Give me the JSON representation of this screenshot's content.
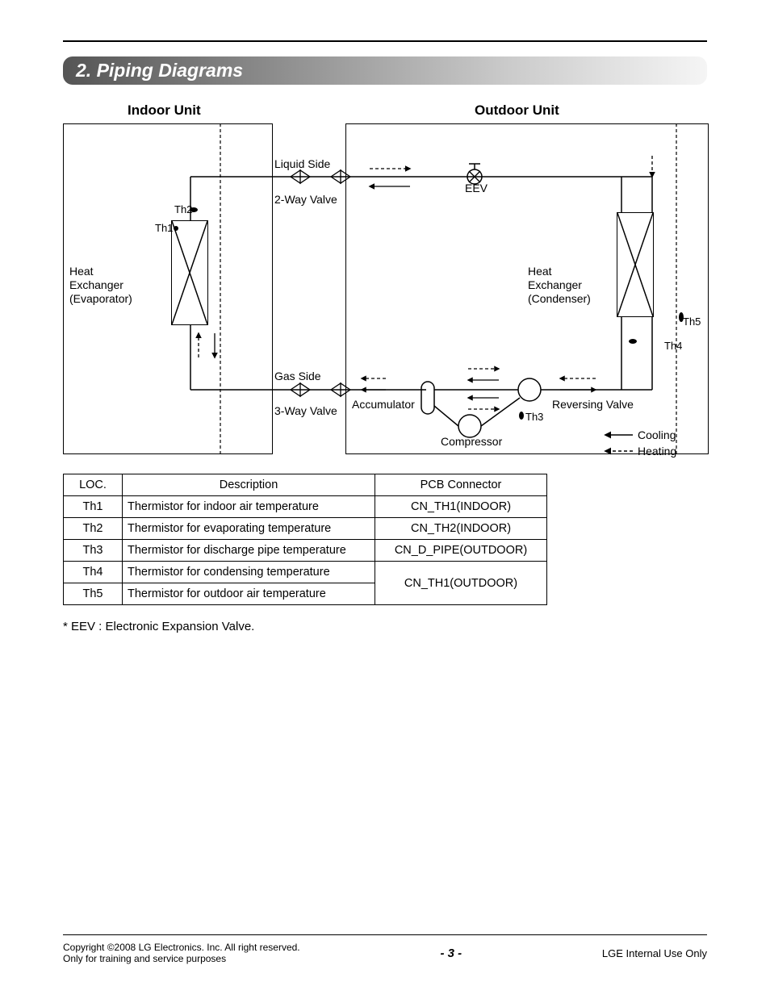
{
  "section_title": "2. Piping Diagrams",
  "diagram": {
    "indoor_unit": "Indoor Unit",
    "outdoor_unit": "Outdoor Unit",
    "liquid_side": "Liquid Side",
    "two_way_valve": "2-Way Valve",
    "gas_side": "Gas Side",
    "three_way_valve": "3-Way Valve",
    "heat_ex_evap_l1": "Heat",
    "heat_ex_evap_l2": "Exchanger",
    "heat_ex_evap_l3": "(Evaporator)",
    "heat_ex_cond_l1": "Heat",
    "heat_ex_cond_l2": "Exchanger",
    "heat_ex_cond_l3": "(Condenser)",
    "eev": "EEV",
    "accumulator": "Accumulator",
    "compressor": "Compressor",
    "reversing_valve": "Reversing Valve",
    "th1": "Th1",
    "th2": "Th2",
    "th3": "Th3",
    "th4": "Th4",
    "th5": "Th5",
    "cooling": "Cooling",
    "heating": "Heating"
  },
  "table": {
    "headers": {
      "loc": "LOC.",
      "desc": "Description",
      "pcb": "PCB Connector"
    },
    "rows": [
      {
        "loc": "Th1",
        "desc": "Thermistor for indoor air temperature",
        "pcb": "CN_TH1(INDOOR)"
      },
      {
        "loc": "Th2",
        "desc": "Thermistor for evaporating temperature",
        "pcb": "CN_TH2(INDOOR)"
      },
      {
        "loc": "Th3",
        "desc": "Thermistor for discharge pipe temperature",
        "pcb": "CN_D_PIPE(OUTDOOR)"
      },
      {
        "loc": "Th4",
        "desc": "Thermistor for condensing temperature",
        "pcb": "CN_TH1(OUTDOOR)"
      },
      {
        "loc": "Th5",
        "desc": "Thermistor for outdoor air temperature",
        "pcb": ""
      }
    ]
  },
  "note": "* EEV : Electronic Expansion Valve.",
  "footer": {
    "copyright_l1": "Copyright ©2008 LG Electronics. Inc. All right reserved.",
    "copyright_l2": "Only for training and service purposes",
    "page": "- 3 -",
    "right": "LGE Internal Use Only"
  }
}
